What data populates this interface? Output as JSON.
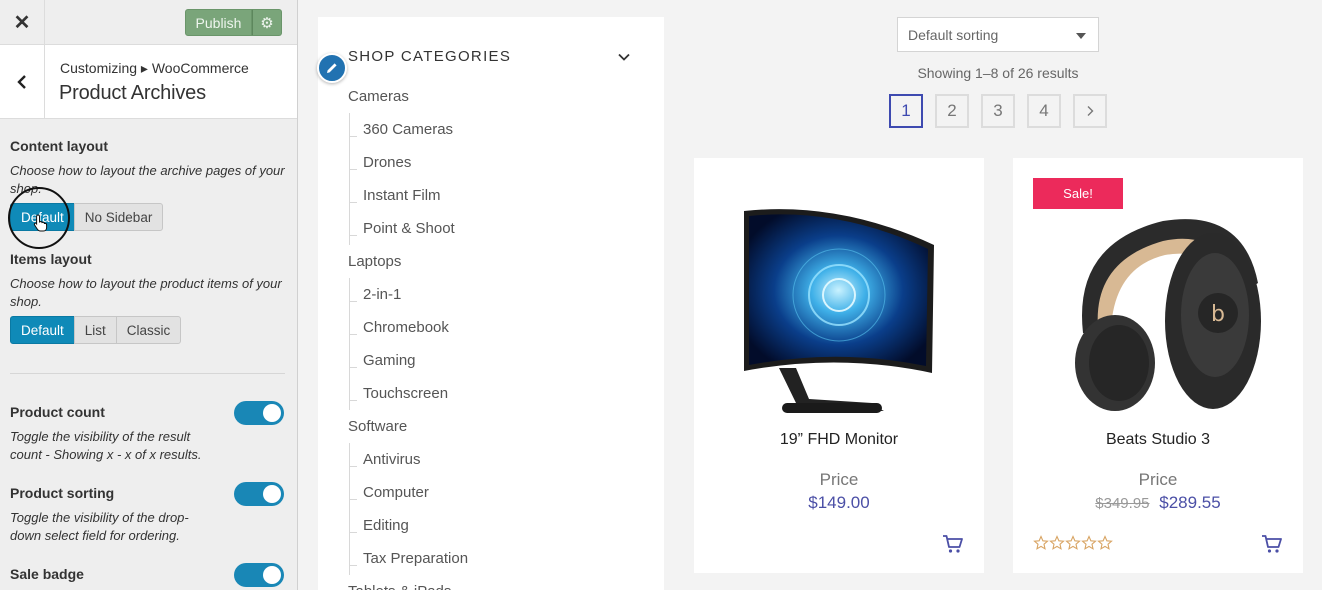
{
  "topbar": {
    "close_icon": "close-icon",
    "publish_label": "Publish",
    "settings_icon": "gear-icon",
    "publish_color": "#7aa57a"
  },
  "header": {
    "breadcrumb": "Customizing ▸ WooCommerce",
    "title": "Product Archives"
  },
  "content_layout": {
    "title": "Content layout",
    "description": "Choose how to layout the archive pages of your shop.",
    "options": [
      "Default",
      "No Sidebar"
    ],
    "selected": "Default"
  },
  "items_layout": {
    "title": "Items layout",
    "description": "Choose how to layout the product items of your shop.",
    "options": [
      "Default",
      "List",
      "Classic"
    ],
    "selected": "Default"
  },
  "product_count": {
    "title": "Product count",
    "description": "Toggle the visibility of the result count - Showing x - x of x results.",
    "enabled": true
  },
  "product_sorting": {
    "title": "Product sorting",
    "description": "Toggle the visibility of the drop-down select field for ordering.",
    "enabled": true
  },
  "sale_badge": {
    "title": "Sale badge",
    "enabled": true
  },
  "accent_color": "#0f8ab8",
  "shop": {
    "categories_title": "SHOP CATEGORIES",
    "categories": [
      {
        "label": "Cameras",
        "child": false
      },
      {
        "label": "360 Cameras",
        "child": true
      },
      {
        "label": "Drones",
        "child": true
      },
      {
        "label": "Instant Film",
        "child": true
      },
      {
        "label": "Point & Shoot",
        "child": true
      },
      {
        "label": "Laptops",
        "child": false
      },
      {
        "label": "2-in-1",
        "child": true
      },
      {
        "label": "Chromebook",
        "child": true
      },
      {
        "label": "Gaming",
        "child": true
      },
      {
        "label": "Touchscreen",
        "child": true
      },
      {
        "label": "Software",
        "child": false
      },
      {
        "label": "Antivirus",
        "child": true
      },
      {
        "label": "Computer",
        "child": true
      },
      {
        "label": "Editing",
        "child": true
      },
      {
        "label": "Tax Preparation",
        "child": true
      },
      {
        "label": "Tablets & iPads",
        "child": false
      }
    ],
    "sorting": "Default sorting",
    "result_count": "Showing 1–8 of 26 results",
    "pages": [
      "1",
      "2",
      "3",
      "4"
    ],
    "current_page": "1",
    "next_icon": "chevron-right-icon",
    "products": [
      {
        "name": "19” FHD Monitor",
        "price_label": "Price",
        "price": "$149.00",
        "old_price": "",
        "sale_badge": "",
        "image": "monitor-image"
      },
      {
        "name": "Beats Studio 3",
        "price_label": "Price",
        "price": "$289.55",
        "old_price": "$349.95",
        "sale_badge": "Sale!",
        "rating": 0,
        "image": "headphones-image"
      }
    ],
    "price_color": "#4b4fa6",
    "sale_color": "#ec2a5b"
  }
}
